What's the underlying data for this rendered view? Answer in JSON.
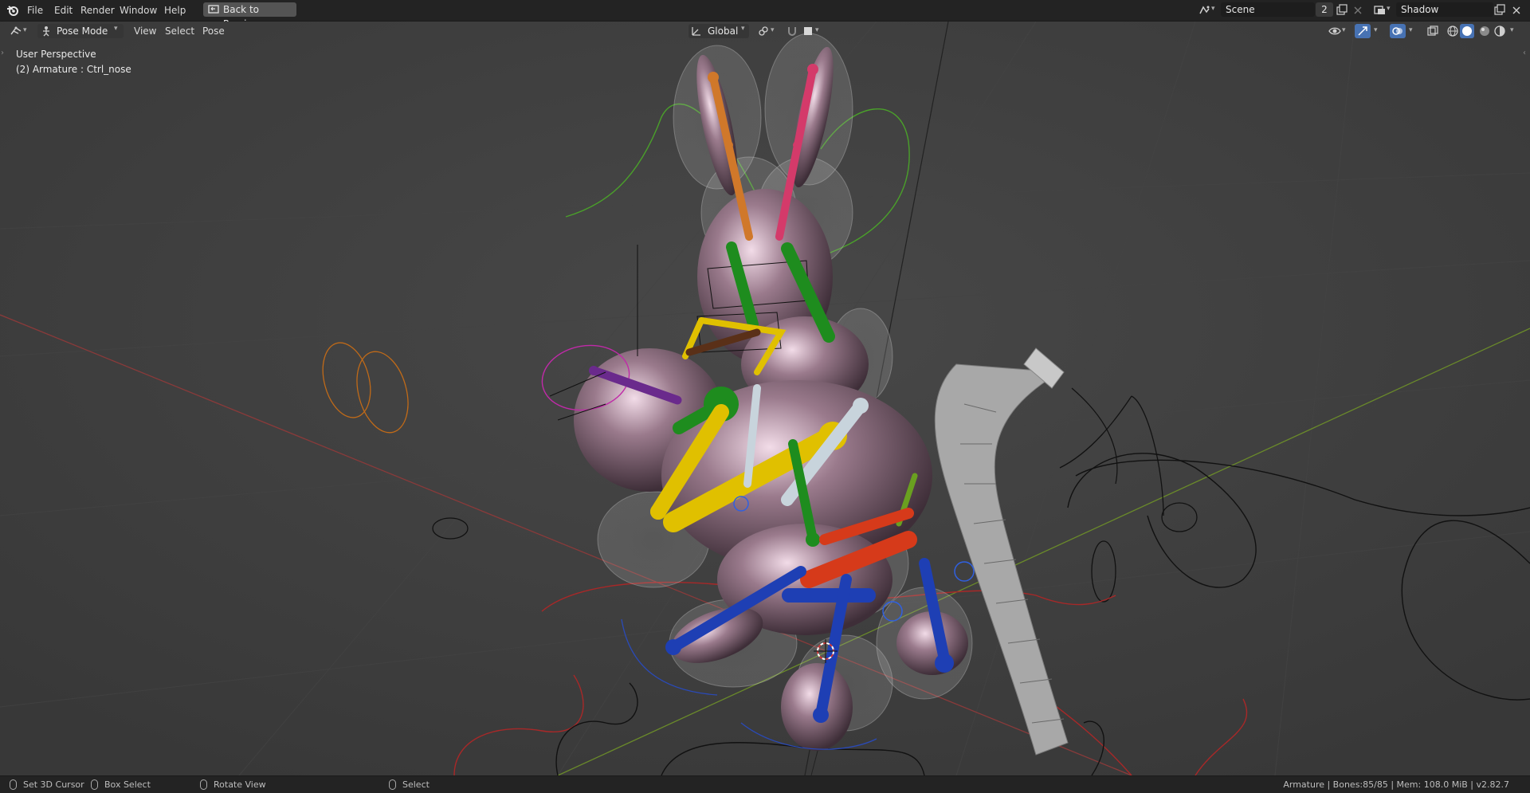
{
  "app": {
    "menu": [
      "File",
      "Edit",
      "Render",
      "Window",
      "Help"
    ],
    "back_button_label": "Back to Previous"
  },
  "scene": {
    "name": "Scene",
    "users": "2",
    "view_layer": "Shadow"
  },
  "header": {
    "mode_label": "Pose Mode",
    "menus": [
      "View",
      "Select",
      "Pose"
    ],
    "transform_orientation": "Global"
  },
  "viewport": {
    "perspective_label": "User Perspective",
    "object_label": "(2) Armature : Ctrl_nose"
  },
  "statusbar": {
    "left": [
      {
        "label": "Set 3D Cursor",
        "icon": "mouse-left-icon"
      },
      {
        "label": "Box Select",
        "icon": "mouse-drag-icon"
      },
      {
        "label": "Rotate View",
        "icon": "mouse-middle-icon"
      },
      {
        "label": "Select",
        "icon": "mouse-right-icon"
      }
    ],
    "stats": "Armature | Bones:85/85 | Mem: 108.0 MiB | v2.82.7"
  },
  "colors": {
    "accent_blue": "#4772b3",
    "bone_green": "#1e8c1e",
    "bone_yellow": "#d4b400",
    "bone_red": "#d63a1a",
    "bone_blue": "#1e3fb4",
    "bone_orange": "#d0782a",
    "bone_pink": "#d43a6a",
    "bone_purple": "#6a2a8c",
    "bone_white": "#c8d4dc",
    "bone_brown": "#5a3018"
  }
}
